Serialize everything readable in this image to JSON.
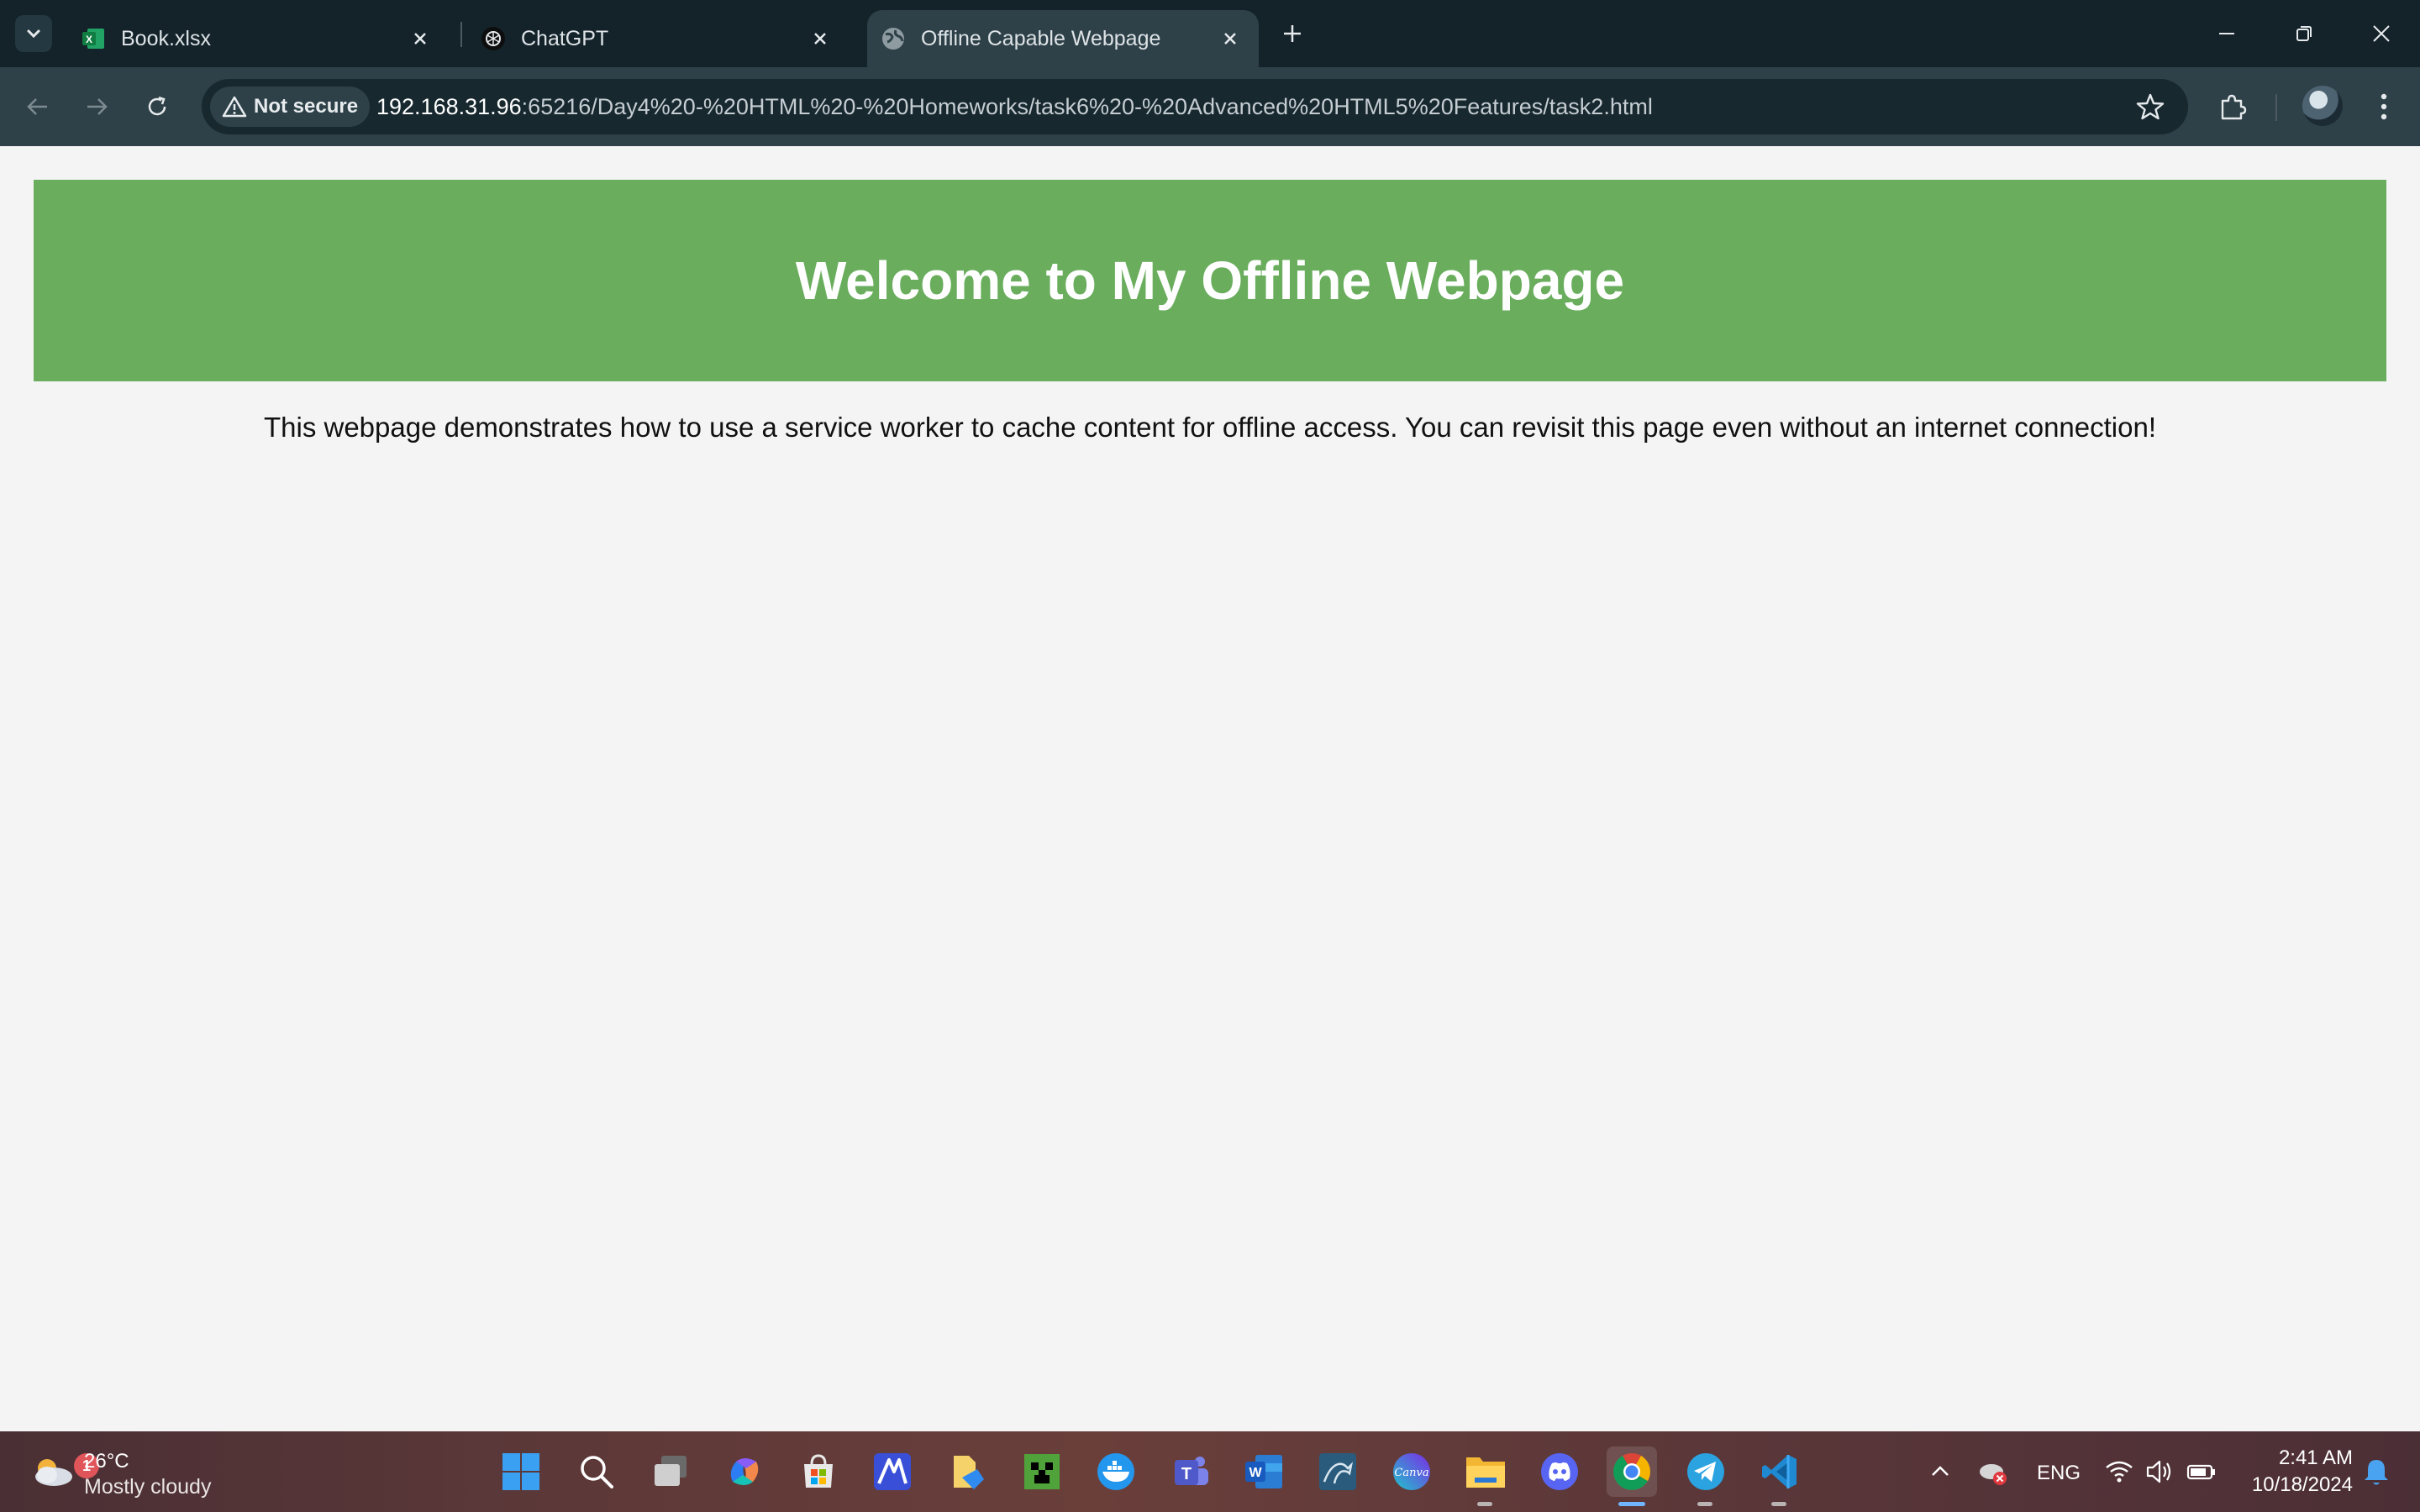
{
  "browser": {
    "tabs": [
      {
        "title": "Book.xlsx",
        "icon": "excel-icon"
      },
      {
        "title": "ChatGPT",
        "icon": "chatgpt-icon"
      },
      {
        "title": "Offline Capable Webpage",
        "icon": "globe-icon",
        "active": true
      }
    ],
    "security_label": "Not secure",
    "url_host": "192.168.31.96",
    "url_rest": ":65216/Day4%20-%20HTML%20-%20Homeworks/task6%20-%20Advanced%20HTML5%20Features/task2.html"
  },
  "page": {
    "heading": "Welcome to My Offline Webpage",
    "paragraph": "This webpage demonstrates how to use a service worker to cache content for offline access. You can revisit this page even without an internet connection!",
    "banner_color": "#69ad5d",
    "background_color": "#f4f4f4"
  },
  "taskbar": {
    "weather": {
      "badge": "1",
      "temperature": "26°C",
      "condition": "Mostly cloudy"
    },
    "apps": [
      "windows-start-icon",
      "search-icon",
      "task-view-icon",
      "copilot-icon",
      "microsoft-store-icon",
      "ai-app-icon",
      "file-explorer-pin-icon",
      "minecraft-icon",
      "docker-icon",
      "teams-icon",
      "word-icon",
      "mysql-icon",
      "canva-icon",
      "folder-icon",
      "discord-icon",
      "chrome-icon",
      "telegram-icon",
      "vscode-icon"
    ],
    "language": "ENG",
    "time": "2:41 AM",
    "date": "10/18/2024"
  }
}
